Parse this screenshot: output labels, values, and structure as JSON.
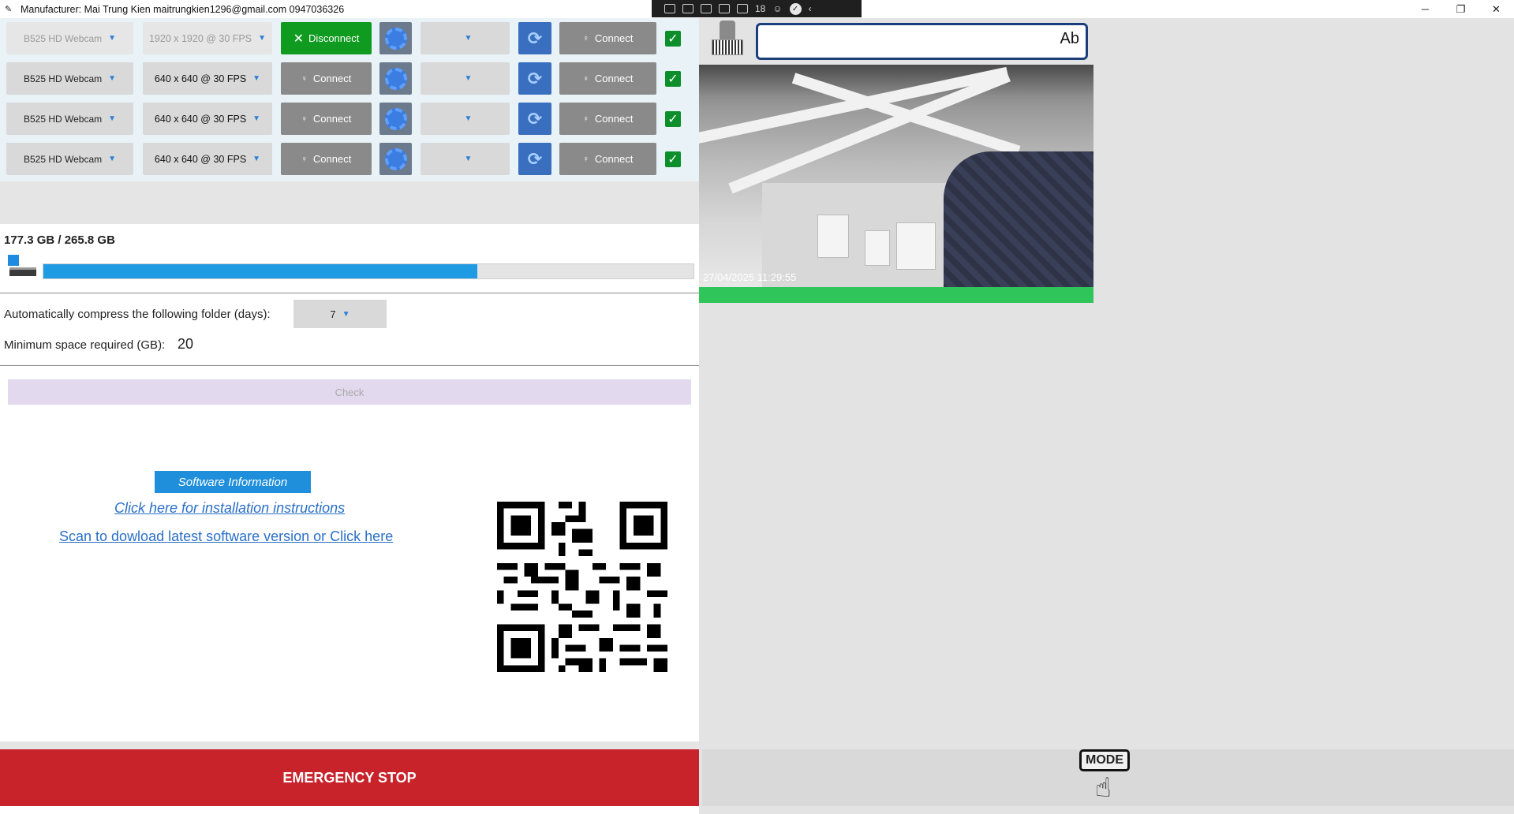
{
  "window": {
    "title": "Manufacturer: Mai Trung Kien maitrungkien1296@gmail.com 0947036326",
    "tray_count": "18",
    "controls": {
      "minimize": "─",
      "restore": "❐",
      "close": "✕"
    }
  },
  "cameras": [
    {
      "camera": "B525 HD Webcam",
      "resolution": "1920 x 1920 @ 30 FPS",
      "connect_label": "Disconnect",
      "connected": true,
      "second_connect": "Connect",
      "enabled": true
    },
    {
      "camera": "B525 HD Webcam",
      "resolution": "640 x 640 @ 30 FPS",
      "connect_label": "Connect",
      "connected": false,
      "second_connect": "Connect",
      "enabled": true
    },
    {
      "camera": "B525 HD Webcam",
      "resolution": "640 x 640 @ 30 FPS",
      "connect_label": "Connect",
      "connected": false,
      "second_connect": "Connect",
      "enabled": true
    },
    {
      "camera": "B525 HD Webcam",
      "resolution": "640 x 640 @ 30 FPS",
      "connect_label": "Connect",
      "connected": false,
      "second_connect": "Connect",
      "enabled": true
    }
  ],
  "storage": {
    "usage_text": "177.3 GB / 265.8 GB",
    "used_fraction": 0.667
  },
  "compress": {
    "label": "Automatically compress the following folder (days):",
    "days": "7"
  },
  "min_space": {
    "label": "Minimum space required (GB):",
    "value": "20"
  },
  "check_label": "Check",
  "info": {
    "button": "Software Information",
    "link_install": "Click here for installation instructions",
    "link_download": "Scan to dowload latest software version or Click here"
  },
  "emergency_label": "EMERGENCY STOP",
  "scanner": {
    "input_value": "",
    "ab_icon": "Ab"
  },
  "video": {
    "timestamp": "27/04/2025 11:29:55"
  },
  "mode_label": "MODE",
  "colors": {
    "connected_green": "#0f9b1f",
    "emergency_red": "#c8222a",
    "progress_blue": "#1f9be3",
    "status_green": "#2fc55a"
  }
}
